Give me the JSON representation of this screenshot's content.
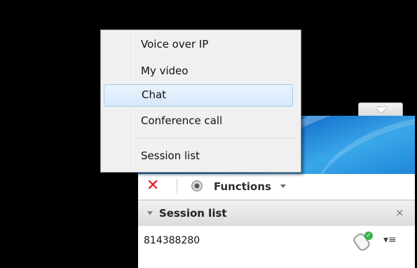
{
  "context_menu": {
    "items": [
      {
        "label": "Voice over IP"
      },
      {
        "label": "My video"
      },
      {
        "label": "Chat",
        "selected": true
      },
      {
        "label": "Conference call"
      },
      {
        "label": "Session list"
      }
    ]
  },
  "toolbar": {
    "close_icon": "close-icon",
    "webcam_icon": "webcam-icon",
    "functions_label": "Functions"
  },
  "session_list": {
    "title": "Session list",
    "close_glyph": "×",
    "rows": [
      {
        "id": "814388280",
        "status_icon": "remote-control-icon"
      }
    ]
  },
  "colors": {
    "accent": "#1b7bd1",
    "close_red": "#e0141e",
    "status_green": "#38b24a"
  }
}
